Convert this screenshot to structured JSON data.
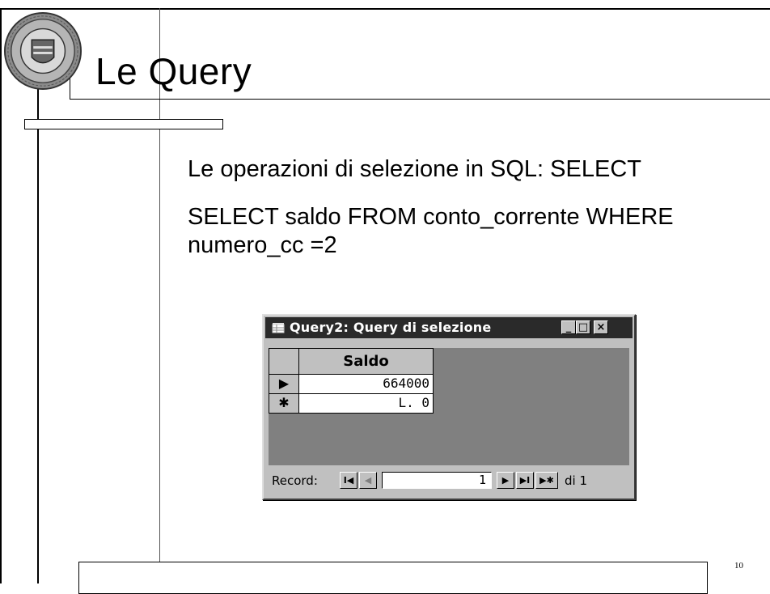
{
  "slide": {
    "title": "Le Query",
    "bullet_1": "Le operazioni di selezione in SQL: SELECT",
    "bullet_2": "SELECT saldo FROM conto_corrente WHERE numero_cc =2",
    "page_number": "10"
  },
  "query_window": {
    "title": "Query2: Query di selezione",
    "minimize_label": "_",
    "maximize_label": "□",
    "close_label": "×",
    "column_header": "Saldo",
    "rows": [
      {
        "selector": "▶",
        "value": "664000"
      },
      {
        "selector": "✱",
        "value": "L. 0"
      }
    ],
    "nav": {
      "label": "Record:",
      "first": "I◀",
      "prev": "◀",
      "current": "1",
      "next": "▶",
      "last": "▶I",
      "new": "▶✱",
      "total": "di 1"
    }
  },
  "colors": {
    "titlebar": "#2a2a2a",
    "window_face": "#c0c0c0",
    "grid_bg": "#808080"
  }
}
